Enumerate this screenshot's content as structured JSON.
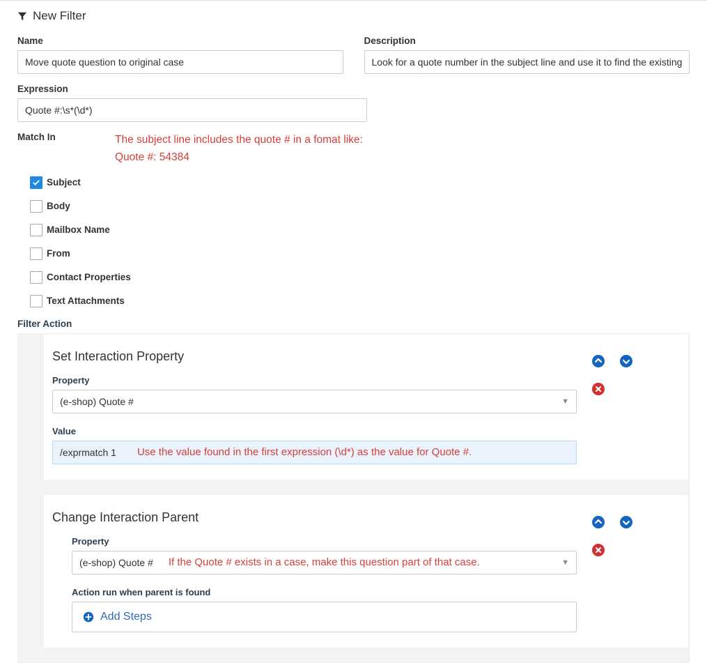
{
  "header": {
    "title": "New Filter"
  },
  "fields": {
    "name_label": "Name",
    "name_value": "Move quote question to original case",
    "description_label": "Description",
    "description_value": "Look for a quote number in the subject line and use it to find the existing case",
    "expression_label": "Expression",
    "expression_value": "Quote #:\\s*(\\d*)"
  },
  "match": {
    "label": "Match In",
    "note_line1": "The subject line includes the quote # in a fomat like:",
    "note_line2": "Quote #: 54384",
    "items": [
      {
        "label": "Subject",
        "checked": true
      },
      {
        "label": "Body",
        "checked": false
      },
      {
        "label": "Mailbox Name",
        "checked": false
      },
      {
        "label": "From",
        "checked": false
      },
      {
        "label": "Contact Properties",
        "checked": false
      },
      {
        "label": "Text Attachments",
        "checked": false
      }
    ]
  },
  "filter_action": {
    "label": "Filter Action",
    "actions": [
      {
        "title": "Set Interaction Property",
        "property_label": "Property",
        "property_value": "(e-shop) Quote #",
        "value_label": "Value",
        "value_text": "/exprmatch 1",
        "value_annotation": "Use the value found in the first expression (\\d*) as the value for Quote #."
      },
      {
        "title": "Change Interaction Parent",
        "property_label": "Property",
        "property_value": "(e-shop) Quote #",
        "property_annotation": "If the Quote # exists in a case, make this question part of that case.",
        "action_run_label": "Action run when parent is found",
        "add_steps_label": "Add Steps"
      }
    ]
  }
}
